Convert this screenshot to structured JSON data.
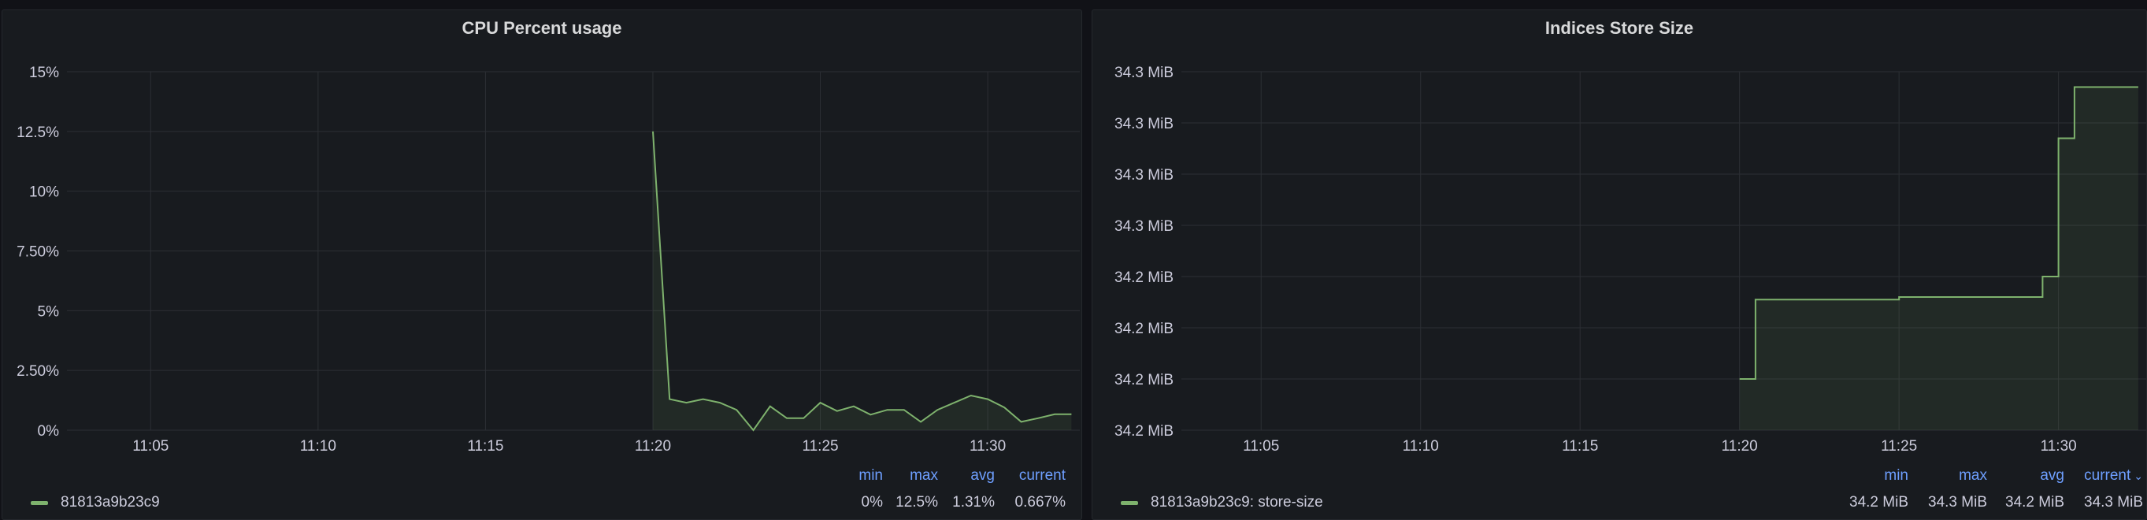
{
  "colors": {
    "series": "#7eb26d",
    "grid": "#2c2f34",
    "background": "#181b1f"
  },
  "chart_data": [
    {
      "type": "line",
      "title": "CPU Percent usage",
      "xlabel": "",
      "ylabel": "",
      "x_ticks": [
        "11:05",
        "11:10",
        "11:15",
        "11:20",
        "11:25",
        "11:30"
      ],
      "y_ticks": [
        "15%",
        "12.5%",
        "10%",
        "7.50%",
        "5%",
        "2.50%",
        "0%"
      ],
      "ylim": [
        0,
        15
      ],
      "xlim": [
        "11:02:30",
        "11:32:45"
      ],
      "grid": true,
      "legend_placement": "bottom",
      "series": [
        {
          "name": "81813a9b23c9",
          "x": [
            "11:20:00",
            "11:20:30",
            "11:21:00",
            "11:21:30",
            "11:22:00",
            "11:22:30",
            "11:23:00",
            "11:23:30",
            "11:24:00",
            "11:24:30",
            "11:25:00",
            "11:25:30",
            "11:26:00",
            "11:26:30",
            "11:27:00",
            "11:27:30",
            "11:28:00",
            "11:28:30",
            "11:29:00",
            "11:29:30",
            "11:30:00",
            "11:30:30",
            "11:31:00",
            "11:31:30",
            "11:32:00",
            "11:32:30"
          ],
          "values": [
            12.5,
            1.3,
            1.15,
            1.3,
            1.15,
            0.85,
            0.0,
            1.0,
            0.5,
            0.5,
            1.15,
            0.8,
            1.0,
            0.65,
            0.85,
            0.85,
            0.35,
            0.85,
            1.15,
            1.45,
            1.3,
            0.95,
            0.35,
            0.5,
            0.667,
            0.667
          ]
        }
      ],
      "legend_headers": [
        "min",
        "max",
        "avg",
        "current"
      ],
      "legend_values": [
        "0%",
        "12.5%",
        "1.31%",
        "0.667%"
      ]
    },
    {
      "type": "area",
      "title": "Indices Store Size",
      "xlabel": "",
      "ylabel": "",
      "x_ticks": [
        "11:05",
        "11:10",
        "11:15",
        "11:20",
        "11:25",
        "11:30"
      ],
      "y_ticks": [
        "34.3 MiB",
        "34.3 MiB",
        "34.3 MiB",
        "34.3 MiB",
        "34.2 MiB",
        "34.2 MiB",
        "34.2 MiB",
        "34.2 MiB"
      ],
      "ylim": [
        0,
        7
      ],
      "xlim": [
        "11:02:30",
        "11:32:45"
      ],
      "grid": true,
      "step": true,
      "legend_placement": "bottom",
      "series": [
        {
          "name": "81813a9b23c9: store-size",
          "x": [
            "11:20:00",
            "11:20:30",
            "11:25:00",
            "11:29:30",
            "11:30:00",
            "11:30:30",
            "11:32:30"
          ],
          "values": [
            1.0,
            2.55,
            2.6,
            3.0,
            5.7,
            6.7,
            6.7
          ]
        }
      ],
      "legend_headers": [
        "min",
        "max",
        "avg",
        "current"
      ],
      "legend_values": [
        "34.2 MiB",
        "34.3 MiB",
        "34.2 MiB",
        "34.3 MiB"
      ]
    }
  ]
}
